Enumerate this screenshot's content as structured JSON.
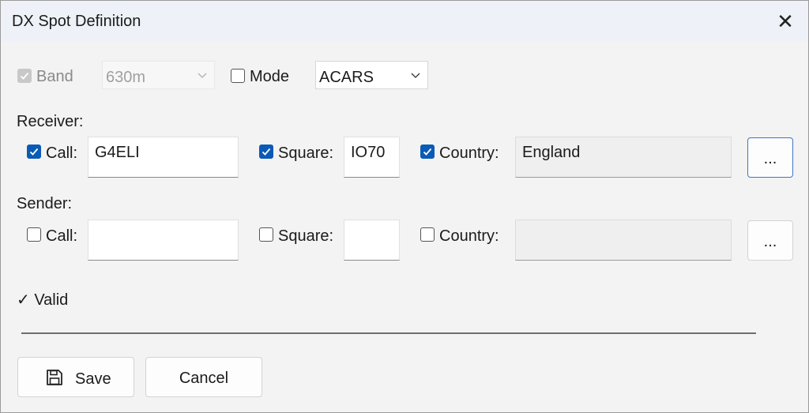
{
  "window": {
    "title": "DX Spot Definition"
  },
  "filters": {
    "band": {
      "label": "Band",
      "value": "630m",
      "checked": true,
      "enabled": false
    },
    "mode": {
      "label": "Mode",
      "value": "ACARS",
      "checked": false
    }
  },
  "receiver": {
    "heading": "Receiver:",
    "call": {
      "label": "Call:",
      "value": "G4ELI",
      "checked": true
    },
    "square": {
      "label": "Square:",
      "value": "IO70",
      "checked": true
    },
    "country": {
      "label": "Country:",
      "value": "England",
      "checked": true
    },
    "browse_label": "..."
  },
  "sender": {
    "heading": "Sender:",
    "call": {
      "label": "Call:",
      "value": "",
      "checked": false
    },
    "square": {
      "label": "Square:",
      "value": "",
      "checked": false
    },
    "country": {
      "label": "Country:",
      "value": "",
      "checked": false
    },
    "browse_label": "..."
  },
  "status": {
    "text": "✓ Valid"
  },
  "buttons": {
    "save": "Save",
    "cancel": "Cancel"
  },
  "colors": {
    "accent": "#0a5bb5",
    "title_bg": "#eef1f7",
    "window_bg": "#f3f3f3"
  }
}
